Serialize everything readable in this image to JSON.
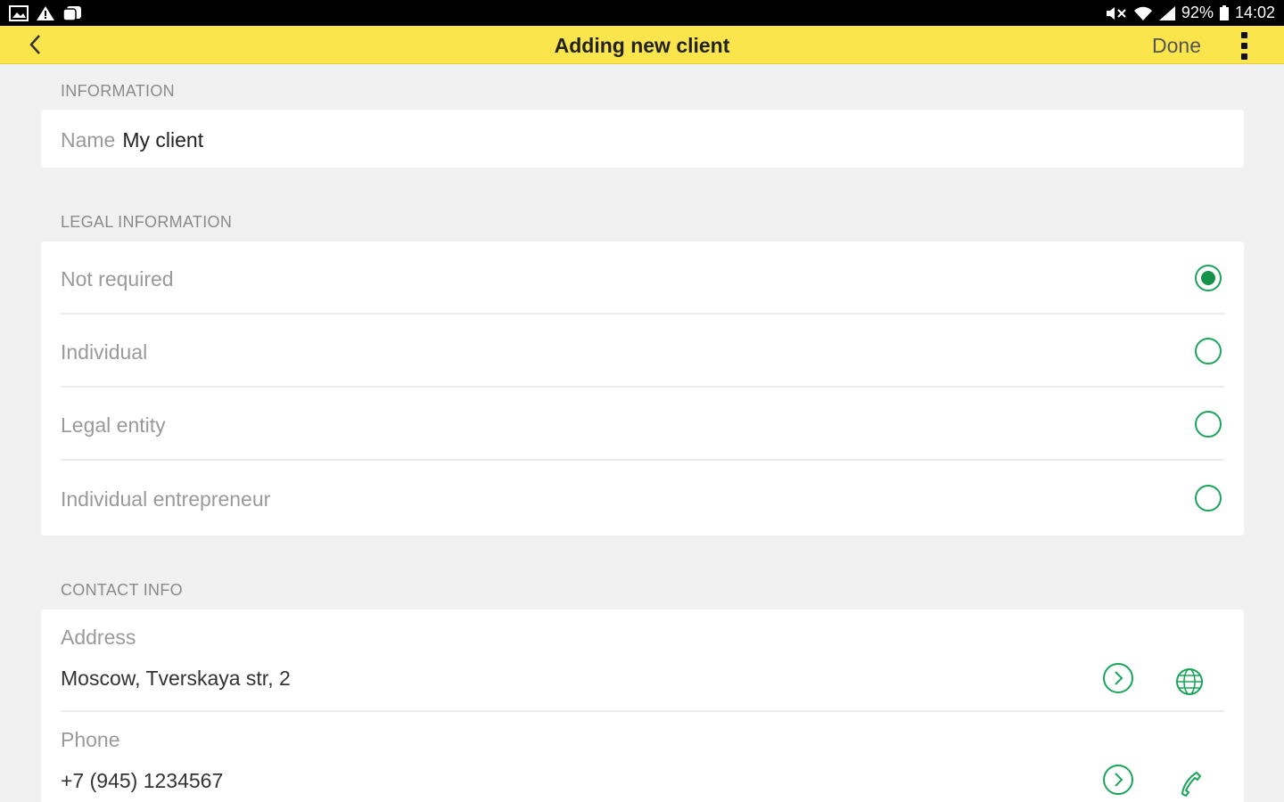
{
  "status_bar": {
    "battery": "92%",
    "time": "14:02"
  },
  "toolbar": {
    "title": "Adding new client",
    "done_label": "Done"
  },
  "sections": {
    "information": "INFORMATION",
    "legal": "LEGAL INFORMATION",
    "contact": "CONTACT INFO"
  },
  "information": {
    "name_label": "Name",
    "name_value": "My client"
  },
  "legal_options": [
    {
      "label": "Not required",
      "selected": true
    },
    {
      "label": "Individual",
      "selected": false
    },
    {
      "label": "Legal entity",
      "selected": false
    },
    {
      "label": "Individual entrepreneur",
      "selected": false
    }
  ],
  "contact": {
    "address_label": "Address",
    "address_value": "Moscow, Tverskaya str, 2",
    "phone_label": "Phone",
    "phone_value": "+7 (945) 1234567"
  },
  "colors": {
    "toolbar": "#fbe54c",
    "accent": "#1aa55a"
  }
}
